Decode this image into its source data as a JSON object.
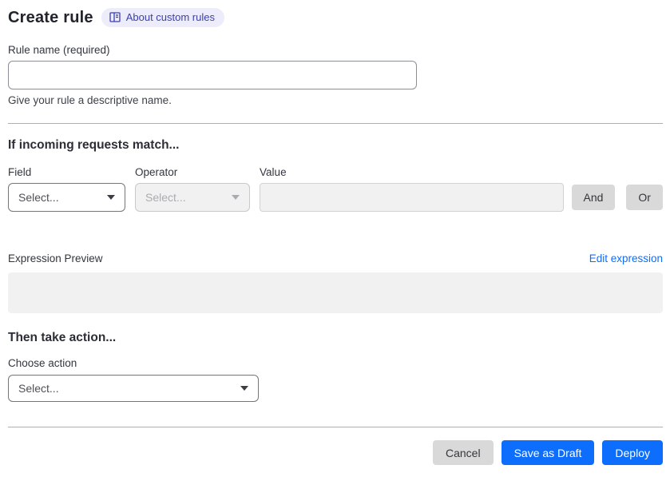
{
  "header": {
    "title": "Create rule",
    "about_badge": {
      "label": "About custom rules",
      "icon": "book-reader-icon"
    }
  },
  "rule_name": {
    "label": "Rule name (required)",
    "value": "",
    "placeholder": "",
    "helper": "Give your rule a descriptive name."
  },
  "match_section": {
    "heading": "If incoming requests match...",
    "field": {
      "label": "Field",
      "selected": "Select...",
      "enabled": true
    },
    "operator": {
      "label": "Operator",
      "selected": "Select...",
      "enabled": false
    },
    "value": {
      "label": "Value",
      "value": "",
      "enabled": false
    },
    "and_button": "And",
    "or_button": "Or"
  },
  "expression": {
    "label": "Expression Preview",
    "edit_link": "Edit expression",
    "preview_content": ""
  },
  "action_section": {
    "heading": "Then take action...",
    "choose_label": "Choose action",
    "selected": "Select..."
  },
  "footer": {
    "cancel": "Cancel",
    "save_draft": "Save as Draft",
    "deploy": "Deploy"
  },
  "colors": {
    "accent_blue": "#0d6efd",
    "badge_background": "#edecfb",
    "badge_text": "#3b3fae",
    "disabled_background": "#f1f1f1",
    "gray_button": "#d9d9d9",
    "divider": "#b0b0b0"
  }
}
